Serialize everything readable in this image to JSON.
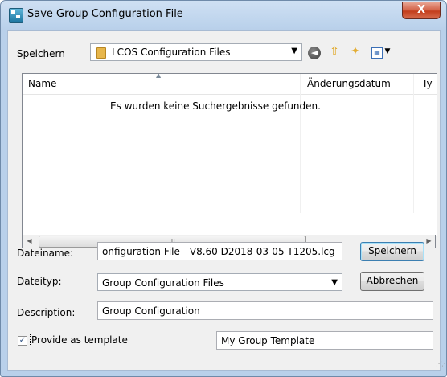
{
  "window": {
    "title": "Save Group Configuration File",
    "close_glyph": "X"
  },
  "toolbar": {
    "save_in_label": "Speichern",
    "folder_name": "LCOS Configuration Files",
    "icons": [
      "back-icon",
      "up-folder-icon",
      "new-folder-icon",
      "views-menu-icon"
    ]
  },
  "file_list": {
    "columns": [
      "Name",
      "Änderungsdatum",
      "Ty"
    ],
    "empty_message": "Es wurden keine Suchergebnisse gefunden."
  },
  "scrollbar": {
    "left_arrow": "◀",
    "right_arrow": "▶",
    "thumb_grip": "|||"
  },
  "form": {
    "filename_label": "Dateiname:",
    "filename_value": "onfiguration File - V8.60 D2018-03-05 T1205.lcg",
    "filetype_label": "Dateityp:",
    "filetype_value": "Group Configuration Files",
    "description_label": "Description:",
    "description_value": "Group Configuration",
    "template_checkbox_label": "Provide as template",
    "template_checked": true,
    "template_name_value": "My Group Template"
  },
  "buttons": {
    "save": "Speichern",
    "cancel": "Abbrechen"
  },
  "colors": {
    "title_gradient_top": "#cfe0f3",
    "close_button": "#c33d1c",
    "client_bg": "#f0f0f0",
    "default_button_border": "#3c7fb1"
  }
}
